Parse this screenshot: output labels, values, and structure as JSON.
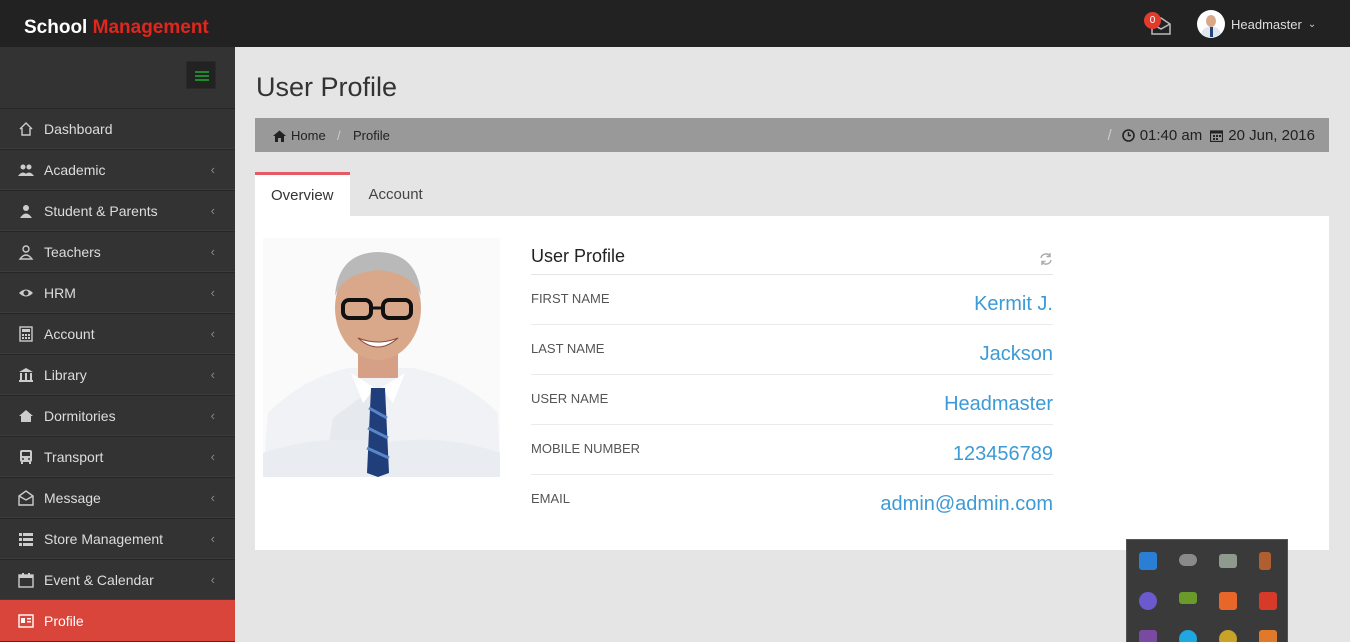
{
  "app": {
    "brand_primary": "School",
    "brand_accent": "Management",
    "accent_color": "#e2261c"
  },
  "topbar": {
    "notification_count": "0",
    "user_name": "Headmaster"
  },
  "sidebar": {
    "items": [
      {
        "label": "Dashboard",
        "icon": "home-icon",
        "has_chevron": false
      },
      {
        "label": "Academic",
        "icon": "users-icon",
        "has_chevron": true
      },
      {
        "label": "Student & Parents",
        "icon": "user-icon",
        "has_chevron": true
      },
      {
        "label": "Teachers",
        "icon": "teacher-icon",
        "has_chevron": true
      },
      {
        "label": "HRM",
        "icon": "eye-icon",
        "has_chevron": true
      },
      {
        "label": "Account",
        "icon": "calculator-icon",
        "has_chevron": true
      },
      {
        "label": "Library",
        "icon": "bank-icon",
        "has_chevron": true
      },
      {
        "label": "Dormitories",
        "icon": "house-icon",
        "has_chevron": true
      },
      {
        "label": "Transport",
        "icon": "bus-icon",
        "has_chevron": true
      },
      {
        "label": "Message",
        "icon": "envelope-icon",
        "has_chevron": true
      },
      {
        "label": "Store Management",
        "icon": "list-icon",
        "has_chevron": true
      },
      {
        "label": "Event & Calendar",
        "icon": "calendar-icon",
        "has_chevron": true
      },
      {
        "label": "Profile",
        "icon": "id-card-icon",
        "has_chevron": false,
        "active": true
      }
    ]
  },
  "page": {
    "title": "User Profile"
  },
  "breadcrumb": {
    "home": "Home",
    "separator": "/",
    "current": "Profile",
    "right_separator": "/",
    "time": "01:40 am",
    "date": "20 Jun, 2016"
  },
  "tabs": [
    {
      "label": "Overview",
      "active": true
    },
    {
      "label": "Account",
      "active": false
    }
  ],
  "profile": {
    "title": "User Profile",
    "fields": [
      {
        "label": "FIRST NAME",
        "value": "Kermit J."
      },
      {
        "label": "LAST NAME",
        "value": "Jackson"
      },
      {
        "label": "USER NAME",
        "value": "Headmaster"
      },
      {
        "label": "MOBILE NUMBER",
        "value": "123456789"
      },
      {
        "label": "EMAIL",
        "value": "admin@admin.com"
      }
    ]
  }
}
